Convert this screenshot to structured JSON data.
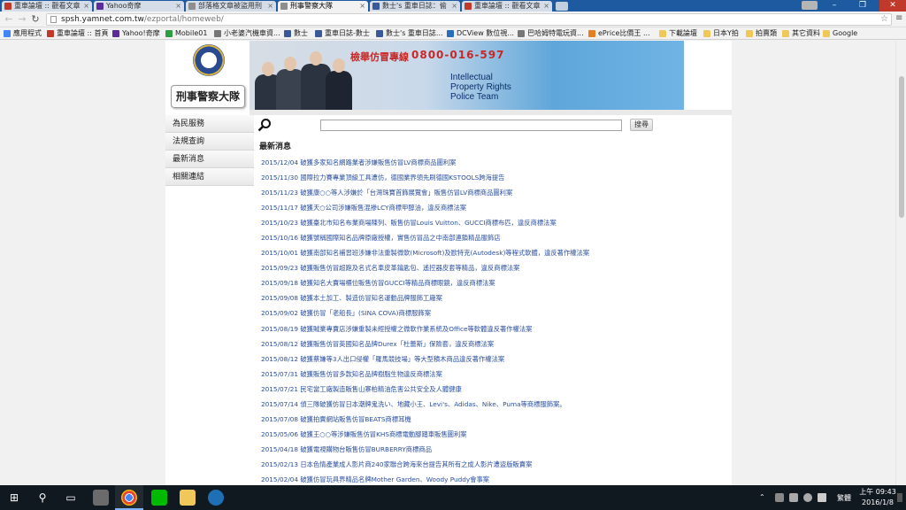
{
  "browser": {
    "tabs": [
      {
        "label": "重車論壇 :: 觀看文章",
        "color": "#c0392b"
      },
      {
        "label": "Yahoo奇摩",
        "color": "#5b2c9a"
      },
      {
        "label": "部落格文章被盜用刑",
        "color": "#8e8e8e"
      },
      {
        "label": "刑事警察大隊",
        "color": "#8e8e8e"
      },
      {
        "label": "數士's 重車日誌：偷",
        "color": "#3b5998"
      },
      {
        "label": "重車論壇 :: 觀看文章",
        "color": "#c0392b"
      }
    ],
    "active_tab": "刑事警察大隊",
    "url_host": "spsh.yamnet.com.tw",
    "url_path": "/ezportal/homeweb/",
    "bookmarks": [
      {
        "label": "應用程式",
        "icon": "apps-grid-icon",
        "color": "#4285f4"
      },
      {
        "label": "重車論壇 :: 首頁",
        "icon": "gmail-icon",
        "color": "#c0392b"
      },
      {
        "label": "Yahoo!奇摩",
        "icon": "yahoo-icon",
        "color": "#5b2c9a"
      },
      {
        "label": "Mobile01",
        "icon": "mobile01-icon",
        "color": "#2e9e44"
      },
      {
        "label": "小老婆汽機車資...",
        "icon": "site-icon",
        "color": "#777777"
      },
      {
        "label": "數士",
        "icon": "facebook-icon",
        "color": "#3b5998"
      },
      {
        "label": "重車日誌-數士",
        "icon": "facebook-icon",
        "color": "#3b5998"
      },
      {
        "label": "數士's 重車日誌...",
        "icon": "blogger-icon",
        "color": "#3b5998"
      },
      {
        "label": "DCView 數位視...",
        "icon": "dcview-icon",
        "color": "#2a6ebb"
      },
      {
        "label": "巴哈姆特電玩資...",
        "icon": "bahamut-icon",
        "color": "#777777"
      },
      {
        "label": "ePrice比價王 ...",
        "icon": "eprice-icon",
        "color": "#e67e22"
      },
      {
        "label": "下載論壇",
        "icon": "folder-icon",
        "color": "#f0c85a"
      },
      {
        "label": "日本Y拍",
        "icon": "folder-icon",
        "color": "#f0c85a"
      },
      {
        "label": "拍賣類",
        "icon": "folder-icon",
        "color": "#f0c85a"
      },
      {
        "label": "其它資料",
        "icon": "folder-icon",
        "color": "#f0c85a"
      },
      {
        "label": "Google",
        "icon": "folder-icon",
        "color": "#f0c85a"
      }
    ]
  },
  "site": {
    "title": "刑事警察大隊",
    "hotline_label": "檢舉仿冒專線",
    "hotline_number": "0800-016-597",
    "ipr_line1": "Intellectual",
    "ipr_line2": "Property Rights",
    "ipr_line3": "Police Team",
    "menu": [
      "為民服務",
      "法規查詢",
      "最新消息",
      "相關連結"
    ],
    "search_button": "搜尋",
    "news_heading": "最新消息",
    "news": [
      "2015/12/04 破獲多家知名網路業者涉嫌販售仿冒LV商標商品圖利案",
      "2015/11/30 國際拉力賽專業頂級工具遭仿，德國業界領先刷德國KSTOOLS跨海提告",
      "2015/11/23 破獲康○○等人涉嫌於「台灣珠寶首飾展覽會」販售仿冒LV商標商品圖利案",
      "2015/11/17 破獲天○公司涉嫌販售混掺LCY商標甲醇油，違反商標法案",
      "2015/10/23 破獲臺北市知名布業商場陳列、販售仿冒Louis Vuitton、GUCCI商標布匹，違反商標法案",
      "2015/10/16 破獲號稱國際知名品牌原廠授權，實售仿冒品之中南部連鎖精品服飾店",
      "2015/10/01 破獲南部知名補習班涉嫌非法重製微軟(Microsoft)及歐特克(Autodesk)等程式軟體，違反著作權法案",
      "2015/09/23 破獲販售仿冒超跑及名式名車皮革鑰匙包、遙控器皮套等精品，違反商標法案",
      "2015/09/18 破獲知名大賣場櫃位販售仿冒GUCCI等精品商標眼鏡，違反商標法案",
      "2015/09/08 破獲本土加工、製造仿冒知名運動品牌服飾工廠案",
      "2015/09/02 破獲仿冒「老船長」(SINA COVA)商標服飾案",
      "2015/08/19 破獲賊業專賣店涉嫌重製未經授權之微軟作業系統及Office等軟體違反著作權法案",
      "2015/08/12 破獲販售仿冒英國知名品牌Durex「杜蕾斯」保險套，違反商標法案",
      "2015/08/12 破獲蔡嫌等3人出口侵權「羅馬競技場」等大型積木商品違反著作權法案",
      "2015/07/31 破獲販售仿冒多款知名品牌樹脂生物違反商標法案",
      "2015/07/21 民宅當工廠製造販售山寨柏精油危害公共安全及人體健康",
      "2015/07/14 偵三隊破獲仿冒日本潮牌鬼洗い、地藏小王、Levi's、Adidas、Nike、Puma等商標服飾案。",
      "2015/07/08 破獲拍賣網站販售仿冒BEATS商標耳機",
      "2015/05/06 破獲王○○等涉嫌販售仿冒KHS商標電動腳踏車販售圖利案",
      "2015/04/18 破獲電視購物台販售仿冒BURBERRY商標商品",
      "2015/02/13 日本色情產業成人影片商240家聯合跨海來台提告其所有之成人影片遭盜版販賣案",
      "2015/02/04 破獲仿冒玩具界精品名牌Mother Garden、Woody Puddy會事案"
    ]
  },
  "taskbar": {
    "ime_label": "繁體",
    "time": "上午 09:43",
    "date": "2016/1/8"
  }
}
